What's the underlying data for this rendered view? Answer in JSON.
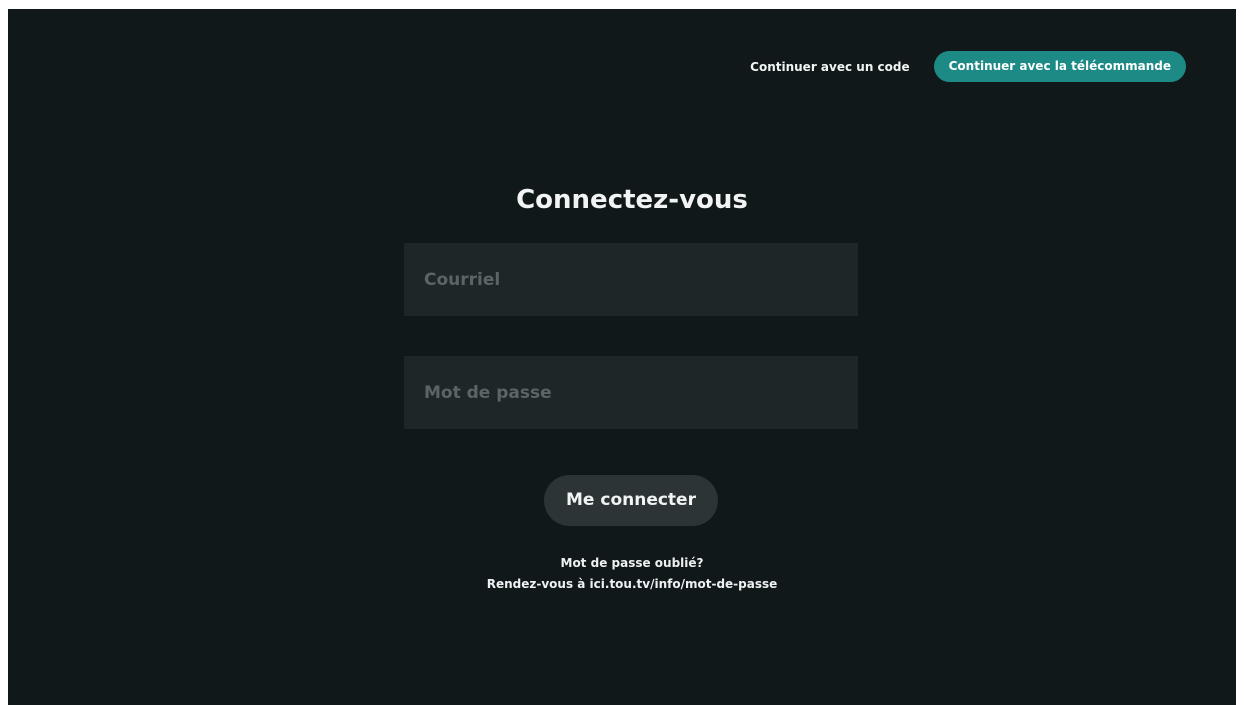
{
  "header": {
    "code_link": "Continuer avec un code",
    "remote_button": "Continuer avec la télécommande"
  },
  "login": {
    "title": "Connectez-vous",
    "email_placeholder": "Courriel",
    "password_placeholder": "Mot de passe",
    "submit": "Me connecter"
  },
  "help": {
    "forgot": "Mot de passe oublié?",
    "prefix": "Rendez-vous à ",
    "url": "ici.tou.tv/info/mot-de-passe"
  },
  "colors": {
    "accent": "#1e8a86",
    "background": "#11181a",
    "field": "#1e2628",
    "button": "#2d3436"
  }
}
